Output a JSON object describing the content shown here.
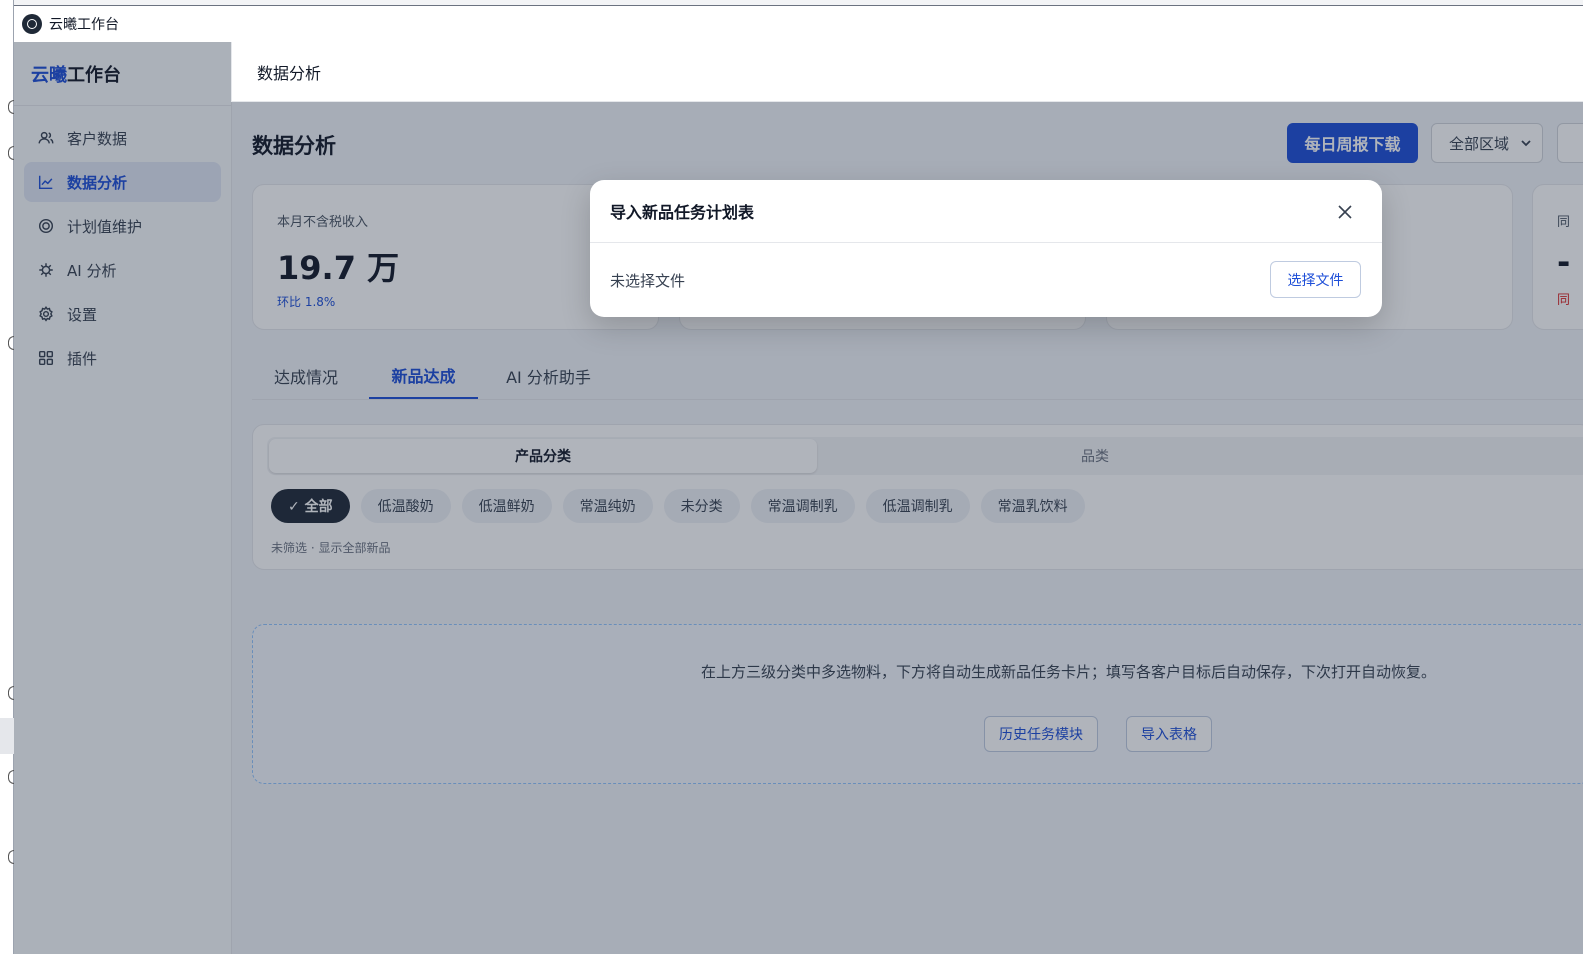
{
  "window": {
    "title": "云曦工作台"
  },
  "sidebar": {
    "brand_part1": "云曦",
    "brand_part2": "工作台",
    "items": [
      {
        "label": "客户数据",
        "icon": "users-icon"
      },
      {
        "label": "数据分析",
        "icon": "chart-line-icon",
        "active": true
      },
      {
        "label": "计划值维护",
        "icon": "target-icon"
      },
      {
        "label": "AI 分析",
        "icon": "ai-chip-icon"
      },
      {
        "label": "设置",
        "icon": "gear-icon"
      },
      {
        "label": "插件",
        "icon": "grid-icon"
      }
    ]
  },
  "header": {
    "title": "数据分析"
  },
  "main": {
    "page_title": "数据分析",
    "download_button": "每日周报下载",
    "region_select": "全部区域",
    "stats": [
      {
        "label": "本月不含税收入",
        "value": "19.7 万",
        "change": "环比 1.8%"
      },
      {
        "label": "同",
        "value": "-",
        "note": "同"
      }
    ],
    "tabs": [
      {
        "label": "达成情况"
      },
      {
        "label": "新品达成",
        "active": true
      },
      {
        "label": "AI 分析助手"
      }
    ],
    "segment": [
      {
        "label": "产品分类",
        "active": true
      },
      {
        "label": "品类"
      }
    ],
    "chips": [
      {
        "label": "✓ 全部",
        "active": true
      },
      {
        "label": "低温酸奶"
      },
      {
        "label": "低温鲜奶"
      },
      {
        "label": "常温纯奶"
      },
      {
        "label": "未分类"
      },
      {
        "label": "常温调制乳"
      },
      {
        "label": "低温调制乳"
      },
      {
        "label": "常温乳饮料"
      }
    ],
    "filter_hint": "未筛选 · 显示全部新品",
    "dropzone": {
      "message": "在上方三级分类中多选物料，下方将自动生成新品任务卡片；填写各客户目标后自动保存，下次打开自动恢复。",
      "history_button": "历史任务模块",
      "import_button": "导入表格"
    }
  },
  "modal": {
    "title": "导入新品任务计划表",
    "status_text": "未选择文件",
    "pick_button": "选择文件"
  },
  "colors": {
    "accent": "#1d4ed8",
    "overlay": "#1e293b",
    "danger": "#dc2626"
  }
}
